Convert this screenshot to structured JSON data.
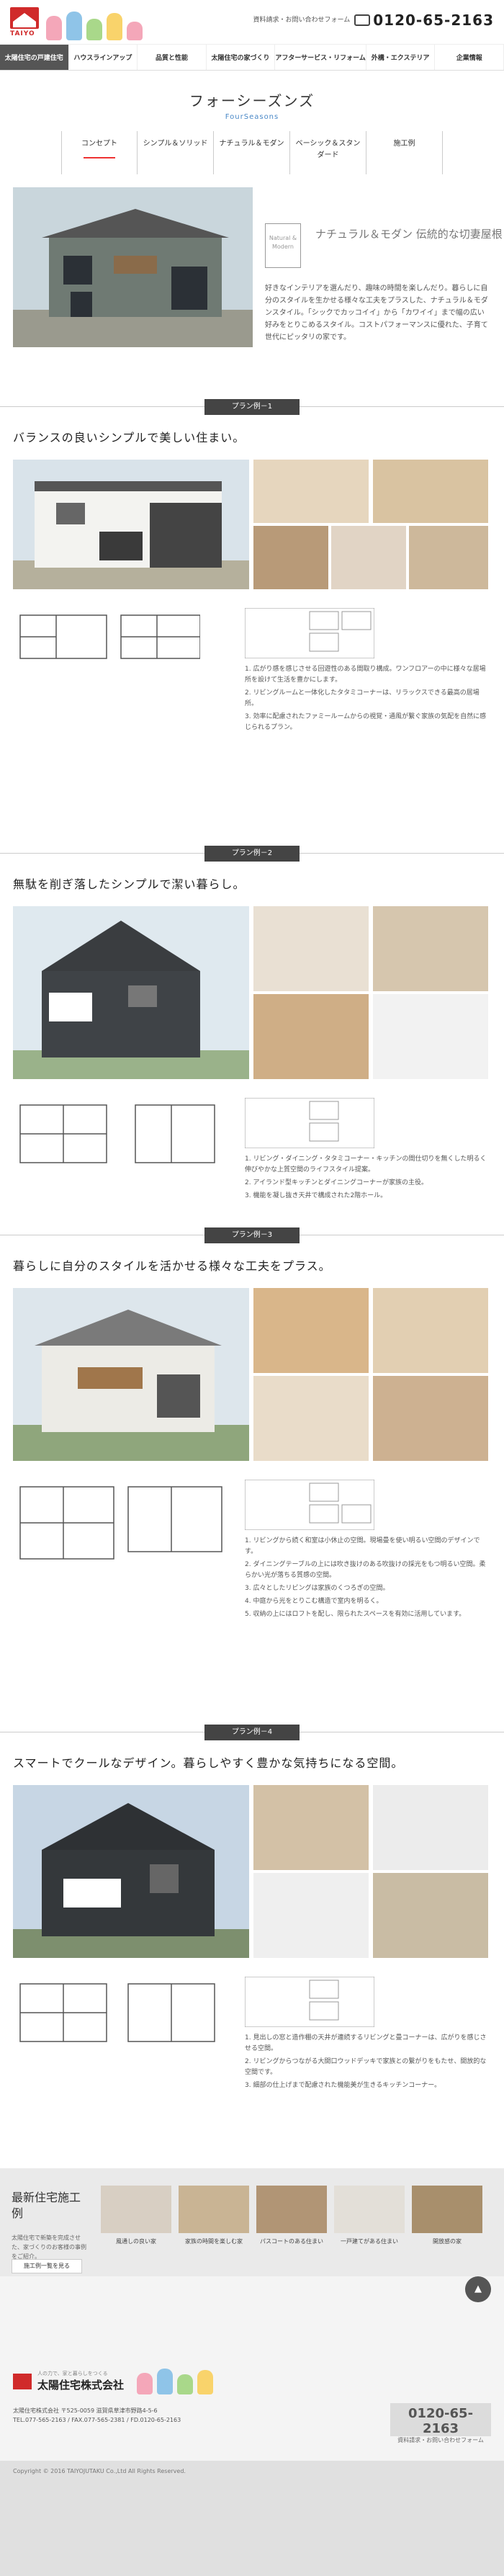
{
  "header": {
    "logo_text": "TAIYO",
    "contact_label": "資料請求・お問い合わせフォーム",
    "tel": "0120-65-2163"
  },
  "nav": [
    {
      "label": "太陽住宅の戸建住宅"
    },
    {
      "label": "ハウスラインアップ"
    },
    {
      "label": "品質と性能"
    },
    {
      "label": "太陽住宅の家づくり"
    },
    {
      "label": "アフターサービス・リフォーム"
    },
    {
      "label": "外構・エクステリア"
    },
    {
      "label": "企業情報"
    }
  ],
  "page": {
    "title": "フォーシーズンズ",
    "subtitle": "FourSeasons"
  },
  "subnav": [
    "コンセプト",
    "シンプル＆ソリッド",
    "ナチュラル＆モダン",
    "ベーシック＆スタンダード",
    "施工例"
  ],
  "intro": {
    "badge": "Natural & Modern",
    "catch": "ナチュラル＆モダン 伝統的な切妻屋根",
    "body": "好きなインテリアを選んだり、趣味の時間を楽しんだり。暮らしに自分のスタイルを生かせる様々な工夫をプラスした、ナチュラル＆モダンスタイル。「シックでカッコイイ」から「カワイイ」まで幅の広い好みをとりこめるスタイル。コストパフォーマンスに優れた、子育て世代にピッタリの家です。"
  },
  "plans": [
    {
      "label": "プラン例－1",
      "heading": "バランスの良いシンプルで美しい住まい。",
      "notes": [
        "1. 広がり感を感じさせる回遊性のある間取り構成。ワンフロアーの中に様々な居場所を設けて生活を豊かにします。",
        "2. リビングルームと一体化したタタミコーナーは、リラックスできる最高の居場所。",
        "3. 効率に配慮されたファミールームからの視覚・通風が繋ぐ家族の気配を自然に感じられるプラン。"
      ]
    },
    {
      "label": "プラン例－2",
      "heading": "無駄を削ぎ落したシンプルで潔い暮らし。",
      "notes": [
        "1. リビング・ダイニング・タタミコーナー・キッチンの間仕切りを無くした明るく伸びやかな上質空間のライフスタイル提案。",
        "2. アイランド型キッチンとダイニングコーナーが家族の主役。",
        "3. 機能を凝し抜き天井で構成された2階ホール。"
      ]
    },
    {
      "label": "プラン例－3",
      "heading": "暮らしに自分のスタイルを活かせる様々な工夫をプラス。",
      "notes": [
        "1. リビングから続く和室は小休止の空間。現場畳を使い明るい空間のデザインです。",
        "2. ダイニングテーブルの上には吹き抜けのある吹抜けの採光をもつ明るい空間。柔らかい光が落ちる質感の空間。",
        "3. 広々としたリビングは家族のくつろぎの空間。",
        "4. 中庭から光をとりこむ構造で室内を明るく。",
        "5. 収納の上にはロフトを配し、限られたスペースを有効に活用しています。"
      ]
    },
    {
      "label": "プラン例－4",
      "heading": "スマートでクールなデザイン。暮らしやすく豊かな気持ちになる空間。",
      "notes": [
        "1. 見出しの窓と造作棚の天井が連続するリビングと畳コーナーは、広がりを感じさせる空間。",
        "2. リビングからつながる大開口ウッドデッキで家族との繋がりをもたせ、開放的な空間です。",
        "3. 細部の仕上げまで配慮された機能美が生きるキッチンコーナー。"
      ]
    }
  ],
  "news": {
    "title": "最新住宅施工例",
    "text": "太陽住宅で新築を完成させた、家づくりのお客様の事例をご紹介。",
    "button": "施工例一覧を見る",
    "items": [
      {
        "caption": "風通しの良い家"
      },
      {
        "caption": "家族の時間を楽しむ家"
      },
      {
        "caption": "パスコートのある住まい"
      },
      {
        "caption": "一戸建てがある住まい"
      },
      {
        "caption": "開放感の家"
      }
    ]
  },
  "footer": {
    "company": "太陽住宅株式会社",
    "tagline": "人の力で、家と暮らしをつくる",
    "address": "太陽住宅株式会社 〒525-0059 滋賀県草津市野路4-5-6",
    "tel_line": "TEL.077-565-2163 / FAX.077-565-2381 / FD.0120-65-2163",
    "tel": "0120-65-2163",
    "tel_sub": "資料請求・お問い合わせフォーム",
    "copyright": "Copyright © 2016 TAIYOJUTAKU Co.,Ltd All Rights Reserved."
  },
  "colors": {
    "accent": "#d02a2a",
    "blue": "#4a88c7",
    "bar": "#444444"
  }
}
